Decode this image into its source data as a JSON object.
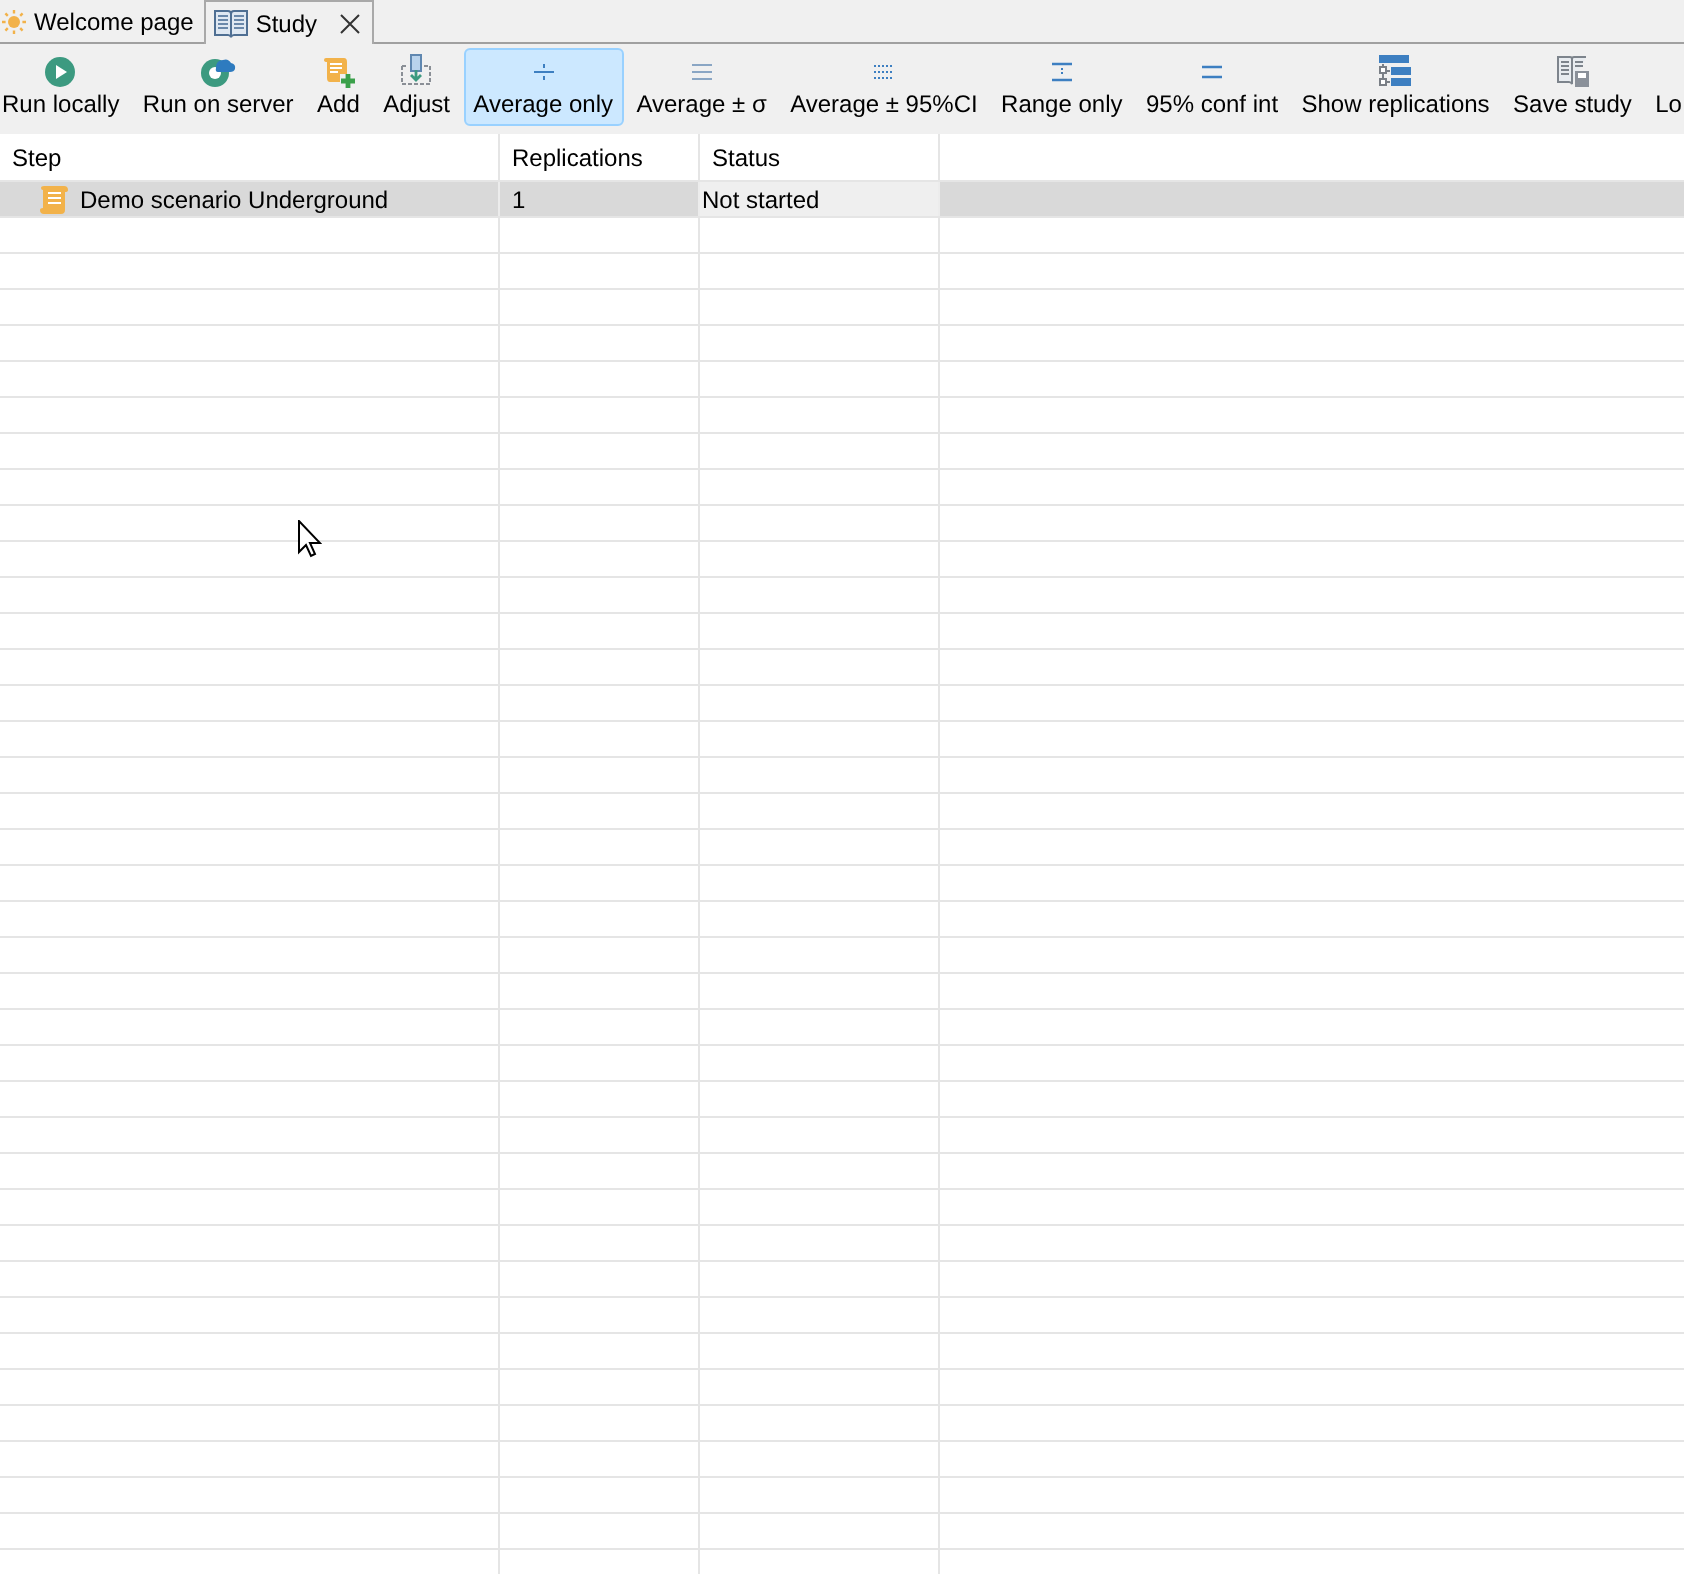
{
  "tabs": [
    {
      "label": "Welcome page",
      "kind": "welcome",
      "selected": false,
      "closable": false
    },
    {
      "label": "Study",
      "kind": "study",
      "selected": true,
      "closable": true
    }
  ],
  "toolbar": [
    {
      "label": "Run locally",
      "kind": "run-local",
      "selected": false
    },
    {
      "label": "Run on server",
      "kind": "run-server",
      "selected": false
    },
    {
      "label": "Add",
      "kind": "add",
      "selected": false
    },
    {
      "label": "Adjust",
      "kind": "adjust",
      "selected": false
    },
    {
      "label": "Average only",
      "kind": "average",
      "selected": true
    },
    {
      "label": "Average ± σ",
      "kind": "average-sd",
      "selected": false
    },
    {
      "label": "Average ± 95%CI",
      "kind": "average-ci",
      "selected": false
    },
    {
      "label": "Range only",
      "kind": "range",
      "selected": false
    },
    {
      "label": "95% conf int",
      "kind": "conf-int",
      "selected": false
    },
    {
      "label": "Show replications",
      "kind": "replications",
      "selected": false
    },
    {
      "label": "Save study",
      "kind": "save",
      "selected": false
    },
    {
      "label": "Lo",
      "kind": "cut",
      "selected": false
    }
  ],
  "table": {
    "columns": [
      "Step",
      "Replications",
      "Status"
    ],
    "rows": [
      {
        "step": "Demo scenario Underground",
        "replications": "1",
        "status": "Not started",
        "selected": true,
        "status_focused": true
      }
    ]
  }
}
